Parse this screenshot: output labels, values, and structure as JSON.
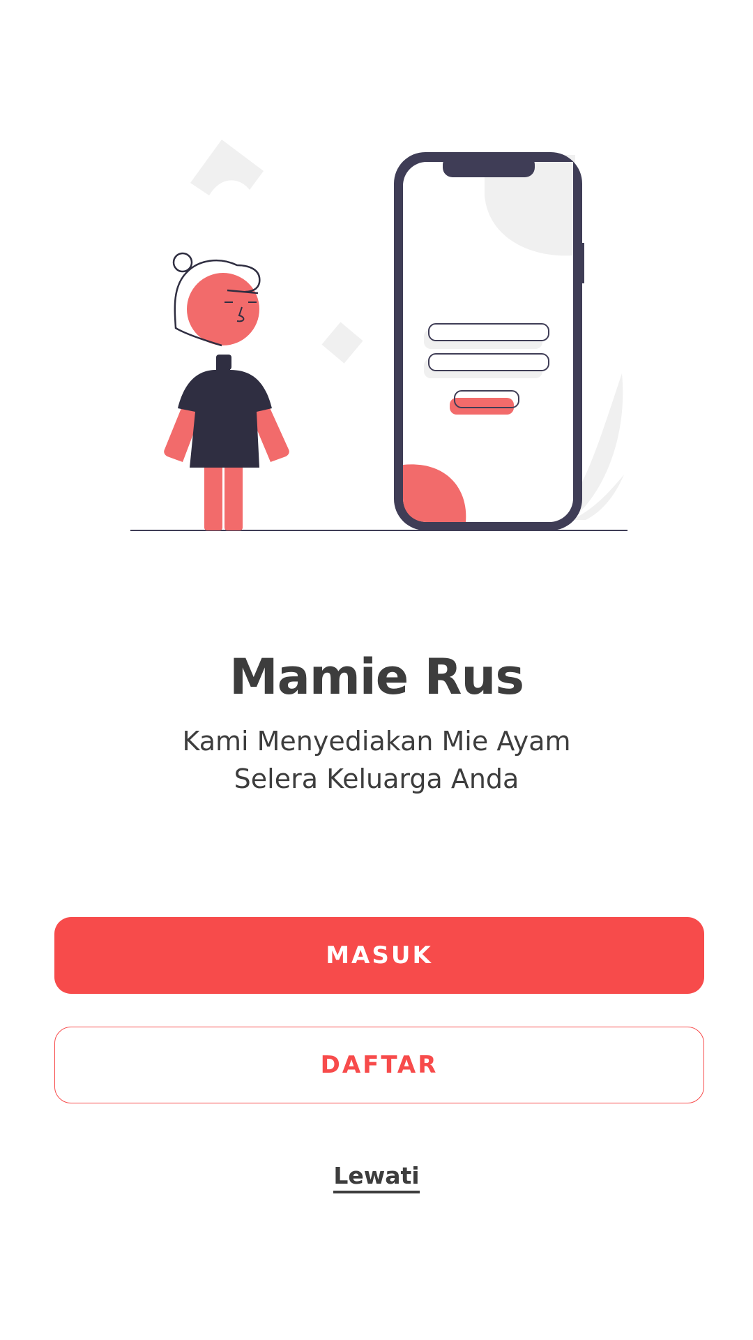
{
  "app": {
    "title": "Mamie Rus",
    "tagline_line1": "Kami Menyediakan Mie Ayam",
    "tagline_line2": "Selera Keluarga Anda"
  },
  "actions": {
    "login_label": "MASUK",
    "register_label": "DAFTAR",
    "skip_label": "Lewati"
  },
  "colors": {
    "accent": "#f74b4b",
    "illustration_accent": "#f26b6b",
    "dark": "#3f3d56",
    "text": "#3d3d3d",
    "light_shape": "#f0f0f0"
  },
  "illustration": {
    "icon": "person-with-phone-illustration"
  }
}
